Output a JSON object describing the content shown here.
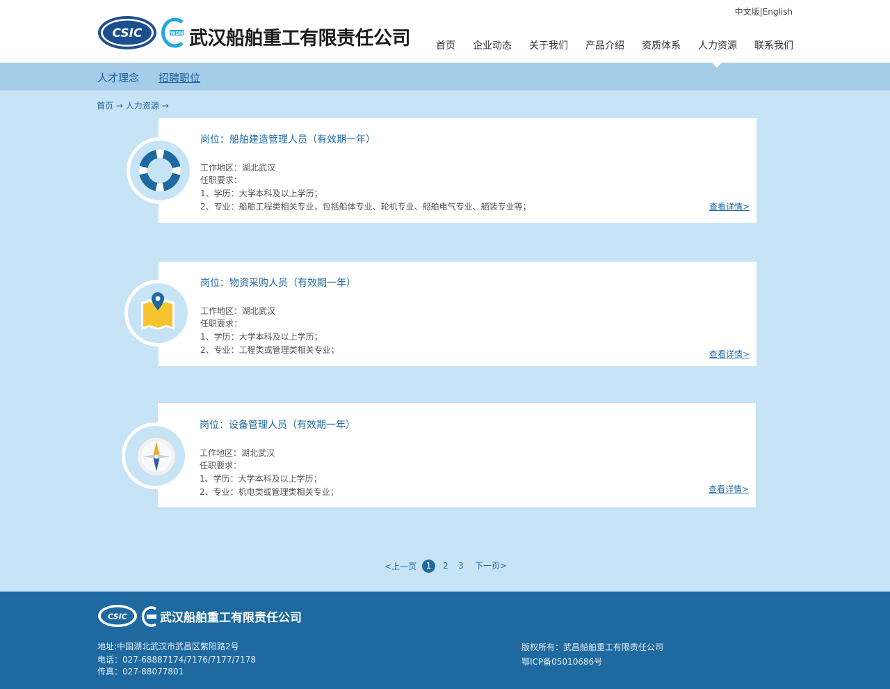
{
  "header": {
    "company_name": "武汉船舶重工有限责任公司",
    "logo_text": "CSIC",
    "lang_cn": "中文版",
    "lang_sep": "|",
    "lang_en": "English",
    "nav": [
      "首页",
      "企业动态",
      "关于我们",
      "产品介绍",
      "资质体系",
      "人力资源",
      "联系我们"
    ],
    "active_nav": "人力资源"
  },
  "subnav": {
    "items": [
      "人才理念",
      "招聘职位"
    ],
    "active": "招聘职位"
  },
  "breadcrumb": {
    "home": "首页",
    "sep": "→",
    "section": "人力资源"
  },
  "jobs": [
    {
      "icon": "lifebuoy-icon",
      "title": "岗位：船舶建造管理人员（有效期一年）",
      "location": "工作地区：湖北武汉",
      "requirements_label": "任职要求：",
      "req1": "1、学历：大学本科及以上学历；",
      "req2": "2、专业：船舶工程类相关专业，包括船体专业、轮机专业、船舶电气专业、舾装专业等；",
      "more": "查看详情>"
    },
    {
      "icon": "map-pin-icon",
      "title": "岗位：物资采购人员（有效期一年）",
      "location": "工作地区：湖北武汉",
      "requirements_label": "任职要求：",
      "req1": "1、学历：大学本科及以上学历；",
      "req2": "2、专业：工程类或管理类相关专业；",
      "more": "查看详情>"
    },
    {
      "icon": "compass-icon",
      "title": "岗位：设备管理人员（有效期一年）",
      "location": "工作地区：湖北武汉",
      "requirements_label": "任职要求：",
      "req1": "1、学历：大学本科及以上学历；",
      "req2": "2、专业：机电类或管理类相关专业；",
      "more": "查看详情>"
    }
  ],
  "pagination": {
    "prev": "<上一页",
    "current": "1",
    "pages": [
      "2",
      "3"
    ],
    "next": "下一页>"
  },
  "footer": {
    "company_name": "武汉船舶重工有限责任公司",
    "logo_text": "CSIC",
    "address": "地址:中国湖北武汉市武昌区紫阳路2号",
    "phone": "电话：027-68887174/7176/7177/7178",
    "fax": "传真：027-88077801",
    "copyright": "版权所有：武昌船舶重工有限责任公司",
    "icp": "鄂ICP备05010686号"
  },
  "colors": {
    "brand_blue": "#1d69a0",
    "light_bg": "#c7e3f6",
    "subnav_bg": "#a5cde9",
    "accent_yellow": "#f6c331"
  }
}
